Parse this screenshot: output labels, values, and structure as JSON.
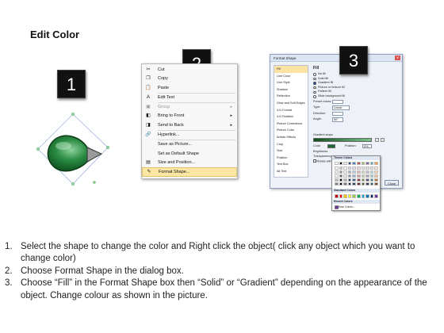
{
  "page_title": "Edit Color",
  "steps": {
    "one": "1",
    "two": "2",
    "three": "3"
  },
  "context_menu": {
    "items": [
      {
        "label": "Cut",
        "icon": "scissors-icon",
        "glyph": "✂"
      },
      {
        "label": "Copy",
        "icon": "copy-icon",
        "glyph": "❐"
      },
      {
        "label": "Paste",
        "icon": "paste-icon",
        "glyph": "📋"
      },
      {
        "label": "Edit Text",
        "icon": "edit-text-icon",
        "glyph": "A"
      },
      {
        "label": "Group",
        "icon": "group-icon",
        "glyph": "▣",
        "submenu": true,
        "disabled": true
      },
      {
        "label": "Bring to Front",
        "icon": "bring-to-front-icon",
        "glyph": "◧",
        "submenu": true
      },
      {
        "label": "Send to Back",
        "icon": "send-to-back-icon",
        "glyph": "◨",
        "submenu": true
      },
      {
        "label": "Hyperlink...",
        "icon": "hyperlink-icon",
        "glyph": "🔗"
      },
      {
        "label": "Save as Picture...",
        "icon": "",
        "glyph": ""
      },
      {
        "label": "Set as Default Shape",
        "icon": "",
        "glyph": ""
      },
      {
        "label": "Size and Position...",
        "icon": "size-position-icon",
        "glyph": "▤"
      },
      {
        "label": "Format Shape...",
        "icon": "format-shape-icon",
        "glyph": "✎",
        "highlighted": true
      }
    ]
  },
  "dialog": {
    "title": "Format Shape",
    "close_label": "Close",
    "nav": [
      "Fill",
      "Line Color",
      "Line Style",
      "Shadow",
      "Reflection",
      "Glow and Soft Edges",
      "3-D Format",
      "3-D Rotation",
      "Picture Corrections",
      "Picture Color",
      "Artistic Effects",
      "Crop",
      "Size",
      "Position",
      "Text Box",
      "Alt Text"
    ],
    "fill_heading": "Fill",
    "fill_options": [
      "No fill",
      "Solid fill",
      "Gradient fill",
      "Picture or texture fill",
      "Pattern fill",
      "Slide background fill"
    ],
    "fields": {
      "preset": "Preset colors:",
      "type": "Type:",
      "type_value": "Linear",
      "direction": "Direction:",
      "angle": "Angle:",
      "angle_value": "90°",
      "gradient_stops": "Gradient stops",
      "color": "Color",
      "position": "Position:",
      "position_value": "0%",
      "brightness": "Brightness:",
      "transparency": "Transparency:",
      "rotate": "Rotate with shape"
    }
  },
  "palette": {
    "theme_heading": "Theme Colors",
    "standard_heading": "Standard Colors",
    "recent_heading": "Recent Colors",
    "more_label": "More Colors...",
    "theme_top": [
      "#ffffff",
      "#000000",
      "#eeece1",
      "#1f497d",
      "#4f81bd",
      "#c0504d",
      "#9bbb59",
      "#8064a2",
      "#4bacc6",
      "#f79646"
    ],
    "standard": [
      "#c00000",
      "#ff0000",
      "#ffc000",
      "#ffff00",
      "#92d050",
      "#00b050",
      "#00b0f0",
      "#0070c0",
      "#002060",
      "#7030a0"
    ]
  },
  "instructions": [
    {
      "num": "1.",
      "text": "Select the shape to change the color and Right click the object( click any object which you want to change color)"
    },
    {
      "num": "2.",
      "text": "Choose Format Shape in the dialog box."
    },
    {
      "num": "3.",
      "text": "Choose “Fill” in the Format Shape box then “Solid” or “Gradient” depending on the appearance of the object. Change colour as shown in the picture."
    }
  ],
  "colors": {
    "shape_green": "#1f7a35",
    "highlight": "#fbe7a3",
    "badge": "#111111"
  }
}
